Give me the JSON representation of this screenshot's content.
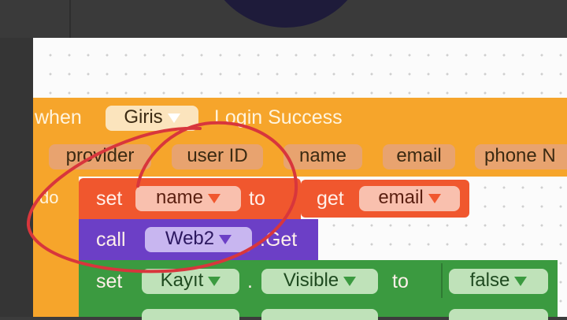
{
  "event_block": {
    "when_label": "when",
    "component": "Giris",
    "event_name": "Login Success",
    "params": [
      "provider",
      "user ID",
      "name",
      "email",
      "phone N"
    ],
    "do_label": "do"
  },
  "statements": {
    "set_name": {
      "set_label": "set",
      "variable": "name",
      "to_label": "to"
    },
    "get_email": {
      "get_label": "get",
      "variable": "email"
    },
    "call_web": {
      "call_label": "call",
      "component": "Web2",
      "method": ".Get"
    },
    "set_kayit": {
      "set_label": "set",
      "component": "Kayıt",
      "property": "Visible",
      "to_label": "to",
      "value": "false"
    }
  },
  "colors": {
    "event": "#f6a52b",
    "variable_set": "#f0572e",
    "procedure_call": "#6c3fc6",
    "component_set": "#3b9a40",
    "annotation": "#d8363c"
  }
}
